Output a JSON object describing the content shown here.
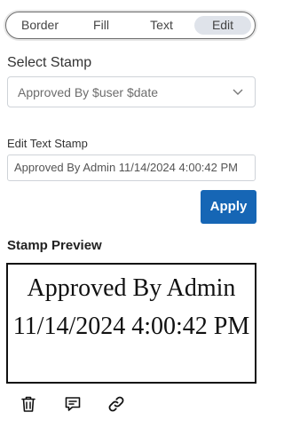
{
  "tabs": [
    {
      "label": "Border",
      "active": false
    },
    {
      "label": "Fill",
      "active": false
    },
    {
      "label": "Text",
      "active": false
    },
    {
      "label": "Edit",
      "active": true
    }
  ],
  "select_stamp": {
    "label": "Select Stamp",
    "value": "Approved By $user $date"
  },
  "edit_text": {
    "label": "Edit Text Stamp",
    "value": "Approved By Admin 11/14/2024 4:00:42 PM"
  },
  "apply_label": "Apply",
  "preview": {
    "label": "Stamp Preview",
    "text": "Approved By Admin 11/14/2024 4:00:42 PM"
  },
  "actions": [
    {
      "icon": "trash-icon"
    },
    {
      "icon": "comment-icon"
    },
    {
      "icon": "link-icon"
    }
  ],
  "colors": {
    "accent": "#1666b5",
    "active_tab": "#dfe3ea"
  }
}
